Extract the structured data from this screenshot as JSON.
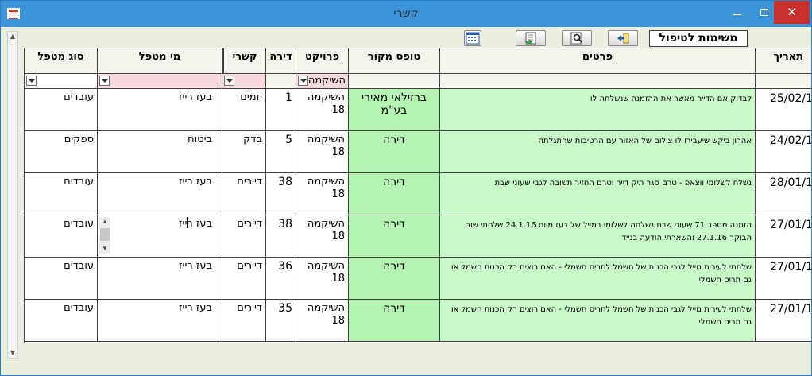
{
  "window": {
    "title": "קשרי"
  },
  "toolbar": {
    "tasks_label": "משימות לטיפול",
    "buttons": [
      "calendar",
      "export",
      "search",
      "back"
    ]
  },
  "columns": {
    "date": "תאריך",
    "details": "פרטים",
    "form_source": "טופס מקור",
    "project": "פרויקט",
    "apartment": "דירה",
    "contact": "קשרי",
    "handler": "מי מטפל",
    "handler_type": "סוג מטפל"
  },
  "filters": {
    "project_value": "השיקמה"
  },
  "rows": [
    {
      "date": "25/02/1",
      "details": "לבדוק אם הדייר מאשר את ההזמנה שנשלחה לו",
      "form_source": "ברזילאי מאירי בע\"מ",
      "project": "השיקמה 18",
      "apartment": "1",
      "contact": "יזמים",
      "handler": "בעז רייז",
      "handler_type": "עובדים"
    },
    {
      "date": "24/02/1",
      "details": "אהרון ביקש שיעבירו לו צילום של האזור עם הרטיבות שהתגלתה",
      "form_source": "דירה",
      "project": "השיקמה 18",
      "apartment": "5",
      "contact": "בדק",
      "handler": "ביטוח",
      "handler_type": "ספקים"
    },
    {
      "date": "28/01/1",
      "details": "נשלח לשלומי ווצאפ - טרם סגר תיק דייר וטרם החזיר תשובה לגבי שעוני שבת",
      "form_source": "דירה",
      "project": "השיקמה 18",
      "apartment": "38",
      "contact": "דיירים",
      "handler": "בעז רייז",
      "handler_type": "עובדים"
    },
    {
      "date": "27/01/1",
      "details": "הזמנה מספר 71 שעוני שבת נשלחה לשלומי במייל של בעז מיום 24.1.16 שלחתי שוב הבוקר 27.1.16 והשארתי הודעה בנייד",
      "form_source": "דירה",
      "project": "השיקמה 18",
      "apartment": "38",
      "contact": "דיירים",
      "handler": "בעז רייז",
      "handler_type": "עובדים"
    },
    {
      "date": "27/01/1",
      "details": "שלחתי לעירית מייל לגבי הכנות של חשמל לתריס חשמלי - האם רוצים רק הכנות חשמל או גם תריס חשמלי",
      "form_source": "דירה",
      "project": "השיקמה 18",
      "apartment": "36",
      "contact": "דיירים",
      "handler": "בעז רייז",
      "handler_type": "עובדים"
    },
    {
      "date": "27/01/1",
      "details": "שלחתי לעירית מייל לגבי הכנות של חשמל לתריס חשמלי - האם רוצים רק הכנות חשמל או גם תריס חשמלי",
      "form_source": "דירה",
      "project": "השיקמה 18",
      "apartment": "35",
      "contact": "דיירים",
      "handler": "בעז רייז",
      "handler_type": "עובדים"
    }
  ],
  "colors": {
    "titlebar": "#3c95d9",
    "close": "#c9302c",
    "green": "#c7f7c6",
    "filter_pink": "#f7d8de"
  }
}
